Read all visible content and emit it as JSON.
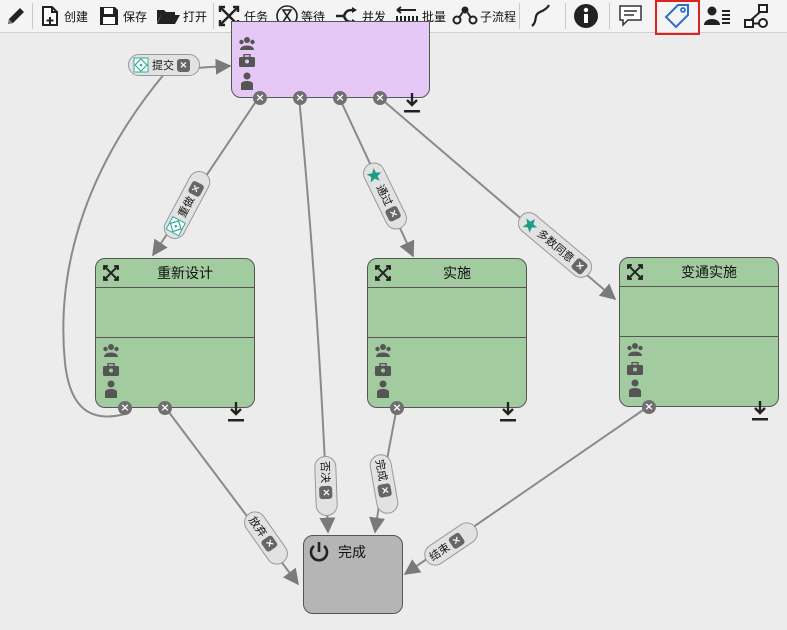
{
  "toolbar": {
    "create": "创建",
    "save": "保存",
    "open": "打开",
    "task": "任务",
    "wait": "等待",
    "parallel": "并发",
    "batch": "批量",
    "subprocess": "子流程"
  },
  "nodes": {
    "redesign": "重新设计",
    "implement": "实施",
    "workaround": "变通实施",
    "finish": "完成"
  },
  "transitions": {
    "submit": "提交",
    "redo": "重做",
    "pass": "通过",
    "majority": "多数同意",
    "reject": "否决",
    "abandon": "放弃",
    "complete": "完成",
    "finish": "结束"
  },
  "colors": {
    "task_fill": "#a3cba0",
    "review_fill": "#e6c8f7",
    "end_fill": "#b5b5b5",
    "selection_border": "#dd2222"
  },
  "selected_tool": "tag"
}
